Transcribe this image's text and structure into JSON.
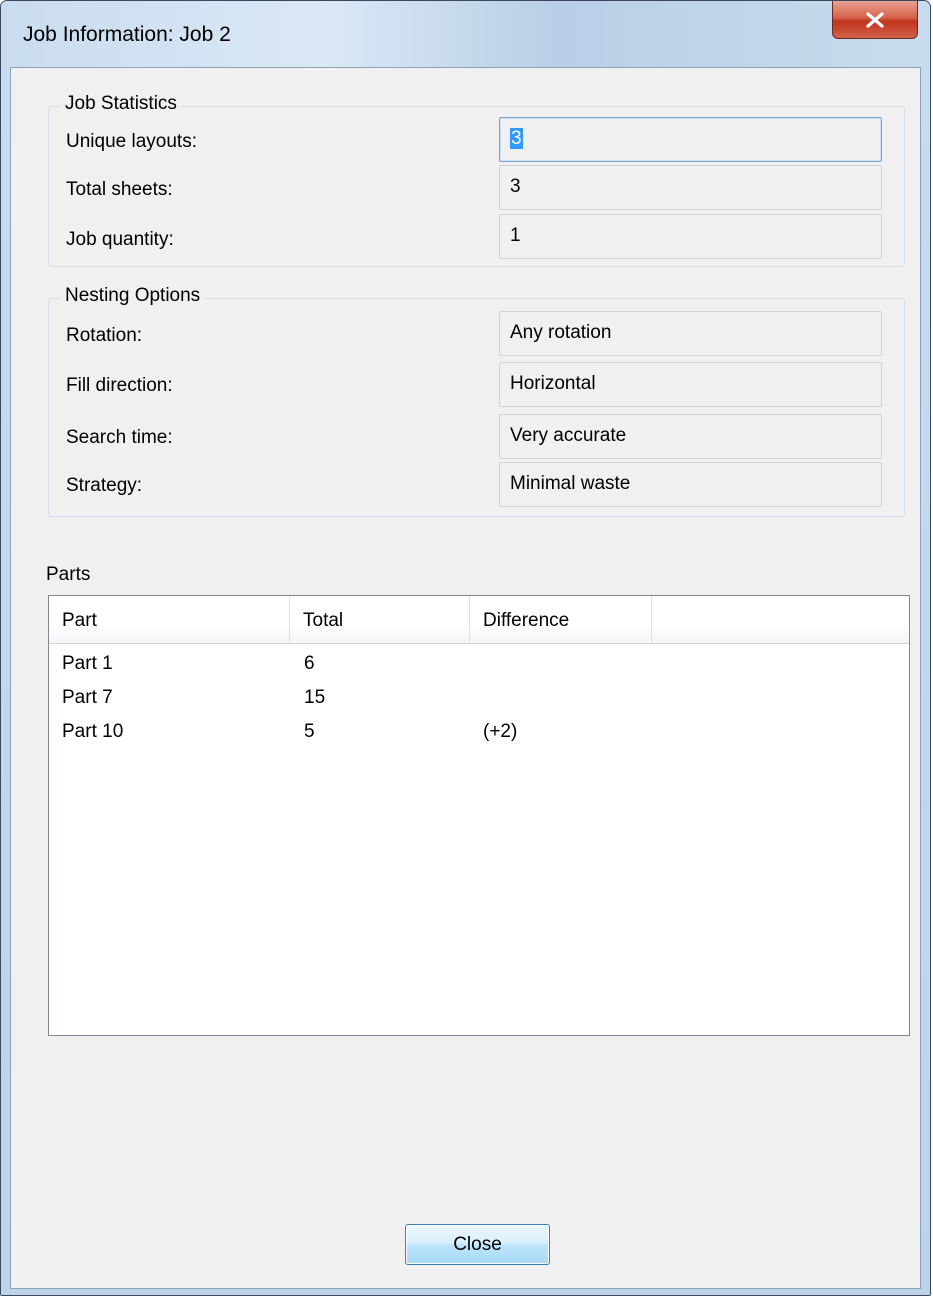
{
  "window": {
    "title": "Job Information: Job 2",
    "close_icon": "close-icon"
  },
  "job_statistics": {
    "title": "Job Statistics",
    "rows": [
      {
        "label": "Unique layouts:",
        "value": "3"
      },
      {
        "label": "Total sheets:",
        "value": "3"
      },
      {
        "label": "Job quantity:",
        "value": "1"
      }
    ]
  },
  "nesting_options": {
    "title": "Nesting Options",
    "rows": [
      {
        "label": "Rotation:",
        "value": "Any rotation"
      },
      {
        "label": "Fill direction:",
        "value": "Horizontal"
      },
      {
        "label": "Search time:",
        "value": "Very accurate"
      },
      {
        "label": "Strategy:",
        "value": "Minimal waste"
      }
    ]
  },
  "parts": {
    "label": "Parts",
    "columns": [
      "Part",
      "Total",
      "Difference"
    ],
    "rows": [
      {
        "part": "Part 1",
        "total": "6",
        "difference": ""
      },
      {
        "part": "Part 7",
        "total": "15",
        "difference": ""
      },
      {
        "part": "Part 10",
        "total": "5",
        "difference": "(+2)"
      }
    ]
  },
  "buttons": {
    "close_label": "Close"
  },
  "colors": {
    "selection": "#3399ff",
    "client_bg": "#f0f0f0",
    "close_button_red": "#c0341d"
  }
}
